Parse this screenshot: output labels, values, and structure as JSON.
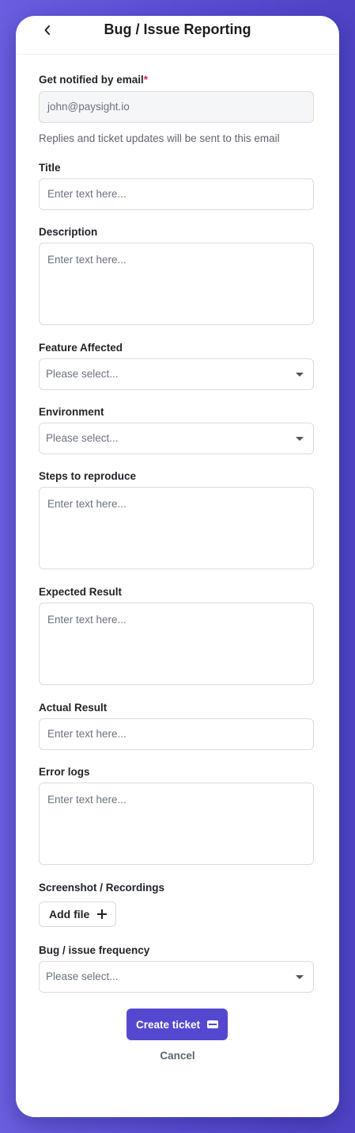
{
  "header": {
    "title": "Bug / Issue Reporting"
  },
  "email": {
    "label": "Get notified by email",
    "required_mark": "*",
    "value": "john@paysight.io",
    "helper": "Replies and ticket updates will be sent to this email"
  },
  "title_field": {
    "label": "Title",
    "placeholder": "Enter text here..."
  },
  "description": {
    "label": "Description",
    "placeholder": "Enter text here..."
  },
  "feature_affected": {
    "label": "Feature Affected",
    "selected": "Please select..."
  },
  "environment": {
    "label": "Environment",
    "selected": "Please select..."
  },
  "steps": {
    "label": "Steps to reproduce",
    "placeholder": "Enter text here..."
  },
  "expected": {
    "label": "Expected Result",
    "placeholder": "Enter text here..."
  },
  "actual": {
    "label": "Actual Result",
    "placeholder": "Enter text here..."
  },
  "error_logs": {
    "label": "Error logs",
    "placeholder": "Enter text here..."
  },
  "attachments": {
    "label": "Screenshot / Recordings",
    "button": "Add file"
  },
  "frequency": {
    "label": "Bug / issue frequency",
    "selected": "Please select..."
  },
  "actions": {
    "create": "Create ticket",
    "cancel": "Cancel"
  },
  "colors": {
    "accent": "#5548d0",
    "required": "#c62d4a",
    "background": "#5b50d6"
  },
  "icons": {
    "back": "chevron-left-icon",
    "add": "plus-icon",
    "create": "ticket-icon",
    "dropdown": "caret-down-icon"
  }
}
